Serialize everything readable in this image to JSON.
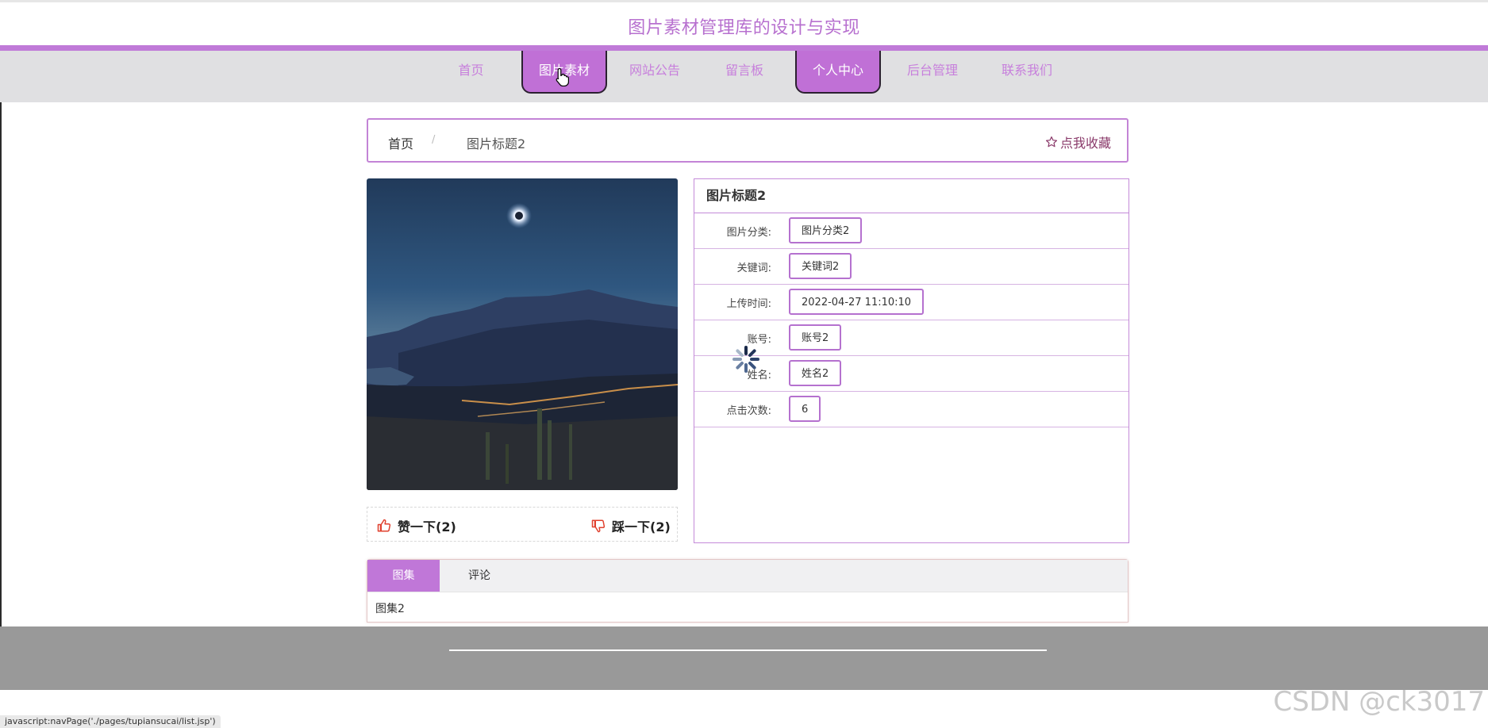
{
  "site": {
    "title": "图片素材管理库的设计与实现"
  },
  "nav": {
    "items": [
      {
        "label": "首页",
        "active": false
      },
      {
        "label": "图片素材",
        "active": true
      },
      {
        "label": "网站公告",
        "active": false
      },
      {
        "label": "留言板",
        "active": false
      },
      {
        "label": "个人中心",
        "active": true
      },
      {
        "label": "后台管理",
        "active": false
      },
      {
        "label": "联系我们",
        "active": false
      }
    ]
  },
  "breadcrumb": {
    "home": "首页",
    "separator": "/",
    "current": "图片标题2",
    "favorite_label": "点我收藏"
  },
  "votes": {
    "like_label": "赞一下(2)",
    "dislike_label": "踩一下(2)"
  },
  "detail": {
    "title": "图片标题2",
    "rows": [
      {
        "label": "图片分类:",
        "value": "图片分类2"
      },
      {
        "label": "关键词:",
        "value": "关键词2"
      },
      {
        "label": "上传时间:",
        "value": "2022-04-27 11:10:10"
      },
      {
        "label": "账号:",
        "value": "账号2"
      },
      {
        "label": "姓名:",
        "value": "姓名2"
      },
      {
        "label": "点击次数:",
        "value": "6"
      }
    ]
  },
  "tabs": {
    "items": [
      "图集",
      "评论"
    ],
    "active_index": 0,
    "content": "图集2"
  },
  "status_bar": "javascript:navPage('./pages/tupiansucai/list.jsp')",
  "watermark": "CSDN @ck3017",
  "colors": {
    "accent": "#c07ad8",
    "nav_bg": "#e0e0e2",
    "footer": "#999999"
  }
}
